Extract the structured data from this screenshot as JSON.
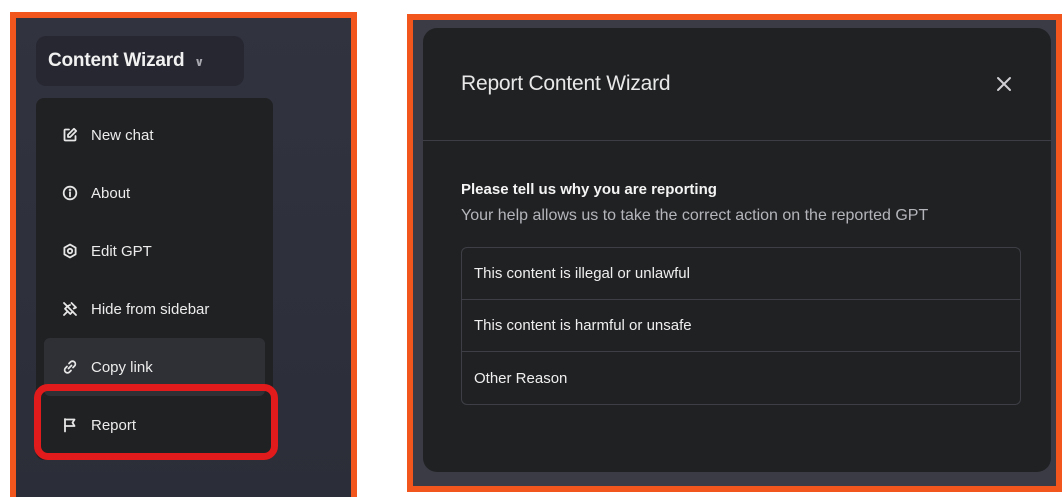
{
  "sidebar": {
    "gpt_name": "Content Wizard",
    "menu_items": [
      {
        "label": "New chat",
        "icon": "edit-icon"
      },
      {
        "label": "About",
        "icon": "info-icon"
      },
      {
        "label": "Edit GPT",
        "icon": "gear-icon"
      },
      {
        "label": "Hide from sidebar",
        "icon": "pin-off-icon"
      },
      {
        "label": "Copy link",
        "icon": "link-icon"
      },
      {
        "label": "Report",
        "icon": "flag-icon"
      }
    ],
    "highlighted_item": "Report"
  },
  "report_dialog": {
    "title": "Report Content Wizard",
    "prompt": "Please tell us why you are reporting",
    "help_text": "Your help allows us to take the correct action on the reported GPT",
    "options": [
      "This content is illegal or unlawful",
      "This content is harmful or unsafe",
      "Other Reason"
    ]
  },
  "colors": {
    "frame": "#f2561d",
    "highlight": "#e11b1b",
    "menu_bg": "#202123",
    "dialog_bg": "#202123",
    "backdrop": "#2f3140"
  }
}
